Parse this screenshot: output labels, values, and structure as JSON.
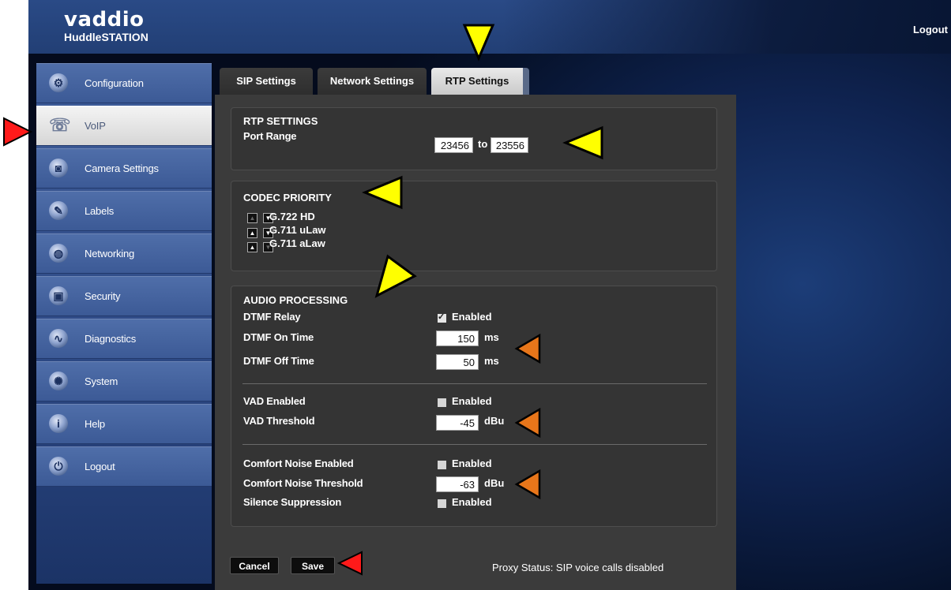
{
  "header": {
    "logo": "vaddio",
    "product": "HuddleSTATION",
    "logout_label": "Logout"
  },
  "sidebar": {
    "items": [
      {
        "label": "Configuration",
        "icon": "gear-icon"
      },
      {
        "label": "VoIP",
        "icon": "phone-icon"
      },
      {
        "label": "Camera Settings",
        "icon": "camera-icon"
      },
      {
        "label": "Labels",
        "icon": "pen-icon"
      },
      {
        "label": "Networking",
        "icon": "globe-icon"
      },
      {
        "label": "Security",
        "icon": "lock-icon"
      },
      {
        "label": "Diagnostics",
        "icon": "pulse-icon"
      },
      {
        "label": "System",
        "icon": "gears-icon"
      },
      {
        "label": "Help",
        "icon": "info-icon"
      },
      {
        "label": "Logout",
        "icon": "power-icon"
      }
    ],
    "active": "VoIP"
  },
  "tabs": [
    {
      "label": "SIP Settings"
    },
    {
      "label": "Network Settings"
    },
    {
      "label": "RTP Settings"
    }
  ],
  "active_tab": "RTP Settings",
  "rtp": {
    "title": "RTP SETTINGS",
    "port_range_label": "Port Range",
    "port_start": "23456",
    "to_label": "to",
    "port_end": "23556"
  },
  "codec": {
    "title": "CODEC PRIORITY",
    "items": [
      "G.722 HD",
      "G.711 uLaw",
      "G.711 aLaw"
    ]
  },
  "audio": {
    "title": "AUDIO PROCESSING",
    "dtmf_relay_label": "DTMF Relay",
    "dtmf_relay_enabled": true,
    "enabled_label": "Enabled",
    "dtmf_on_label": "DTMF On Time",
    "dtmf_on_value": "150",
    "dtmf_off_label": "DTMF Off Time",
    "dtmf_off_value": "50",
    "ms_unit": "ms",
    "vad_enabled_label": "VAD Enabled",
    "vad_enabled": false,
    "vad_threshold_label": "VAD Threshold",
    "vad_threshold_value": "-45",
    "dbu_unit": "dBu",
    "cn_enabled_label": "Comfort Noise Enabled",
    "cn_enabled": false,
    "cn_threshold_label": "Comfort Noise Threshold",
    "cn_threshold_value": "-63",
    "silence_label": "Silence Suppression",
    "silence_enabled": false
  },
  "footer": {
    "cancel_label": "Cancel",
    "save_label": "Save",
    "proxy_status": "Proxy Status: SIP voice calls disabled"
  },
  "colors": {
    "header_blue": "#2a4a86",
    "panel_gray": "#3b3b3b",
    "marker_yellow": "#ffff00",
    "marker_orange": "#e8761a",
    "marker_red": "#ff0000"
  }
}
